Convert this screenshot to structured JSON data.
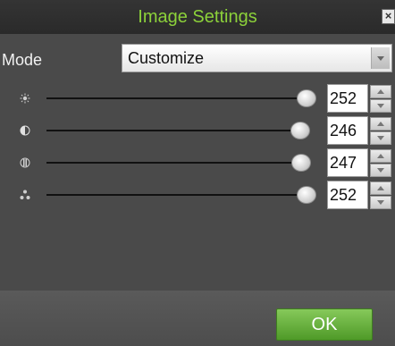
{
  "dialog": {
    "title": "Image Settings",
    "close_glyph": "×",
    "title_color": "#8cd13a"
  },
  "mode": {
    "label": "Mode",
    "value": "Customize"
  },
  "sliders": [
    {
      "name": "brightness",
      "icon": "brightness-icon",
      "value": "252",
      "level": 252,
      "max": 255
    },
    {
      "name": "contrast",
      "icon": "contrast-icon",
      "value": "246",
      "level": 246,
      "max": 255
    },
    {
      "name": "saturation",
      "icon": "saturation-icon",
      "value": "247",
      "level": 247,
      "max": 255
    },
    {
      "name": "hue",
      "icon": "hue-icon",
      "value": "252",
      "level": 252,
      "max": 255
    }
  ],
  "footer": {
    "ok_label": "OK",
    "ok_color": "#5fad34"
  }
}
